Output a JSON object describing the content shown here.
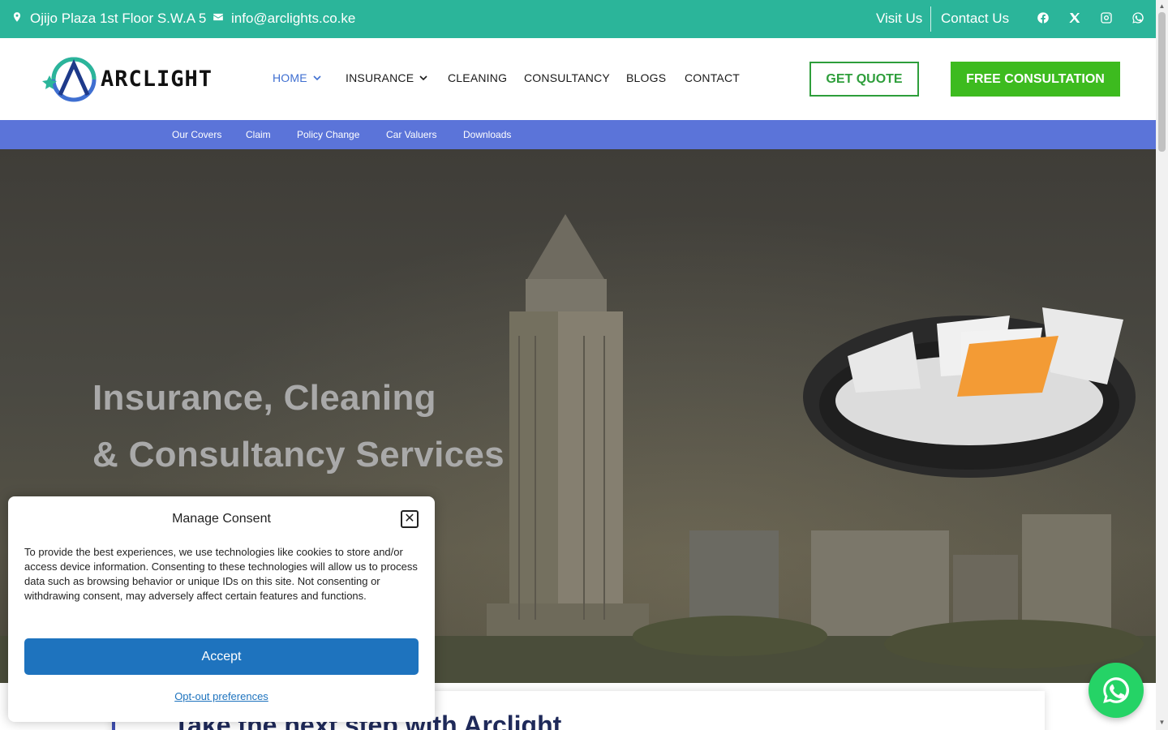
{
  "topbar": {
    "address": "Ojijo Plaza 1st Floor S.W.A 5",
    "email": "info@arclights.co.ke",
    "visit_us": "Visit Us",
    "contact_us": "Contact Us",
    "social_icons": [
      "facebook-icon",
      "x-icon",
      "instagram-icon",
      "whatsapp-icon"
    ]
  },
  "header": {
    "logo_text": "ARCLIGHT",
    "nav": {
      "home": "HOME",
      "insurance": "INSURANCE",
      "cleaning": "CLEANING",
      "consultancy": "CONSULTANCY",
      "blogs": "BLOGS",
      "contact": "CONTACT"
    },
    "get_quote": "GET QUOTE",
    "free_consultation": "FREE CONSULTATION"
  },
  "subnav": {
    "items": [
      "Our Covers",
      "Claim",
      "Policy Change",
      "Car Valuers",
      "Downloads"
    ]
  },
  "hero": {
    "line1": "Insurance, Cleaning",
    "line2": "& Consultancy Services"
  },
  "cta": {
    "title": "Take the next step with Arclight"
  },
  "consent": {
    "title": "Manage Consent",
    "body": "To provide the best experiences, we use technologies like cookies to store and/or access device information. Consenting to these technologies will allow us to process data such as browsing behavior or unique IDs on this site. Not consenting or withdrawing consent, may adversely affect certain features and functions.",
    "accept": "Accept",
    "opt_out": "Opt-out preferences"
  },
  "colors": {
    "topbar": "#2bb59a",
    "subnav": "#5b74d9",
    "nav_active": "#3f6fd1",
    "quote_green": "#2e9e3b",
    "consult_green": "#3dbb1f",
    "accept_blue": "#1e73be",
    "whatsapp": "#25d366"
  }
}
